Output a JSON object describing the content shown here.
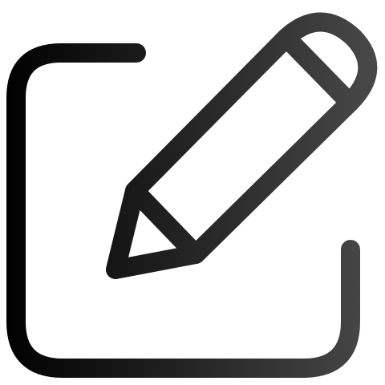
{
  "icon": {
    "name": "edit-icon",
    "parts": [
      "document-frame",
      "pencil"
    ]
  },
  "colors": {
    "background": "#ffffff",
    "stroke_start": "#000000",
    "stroke_end": "#4a4a4a"
  }
}
